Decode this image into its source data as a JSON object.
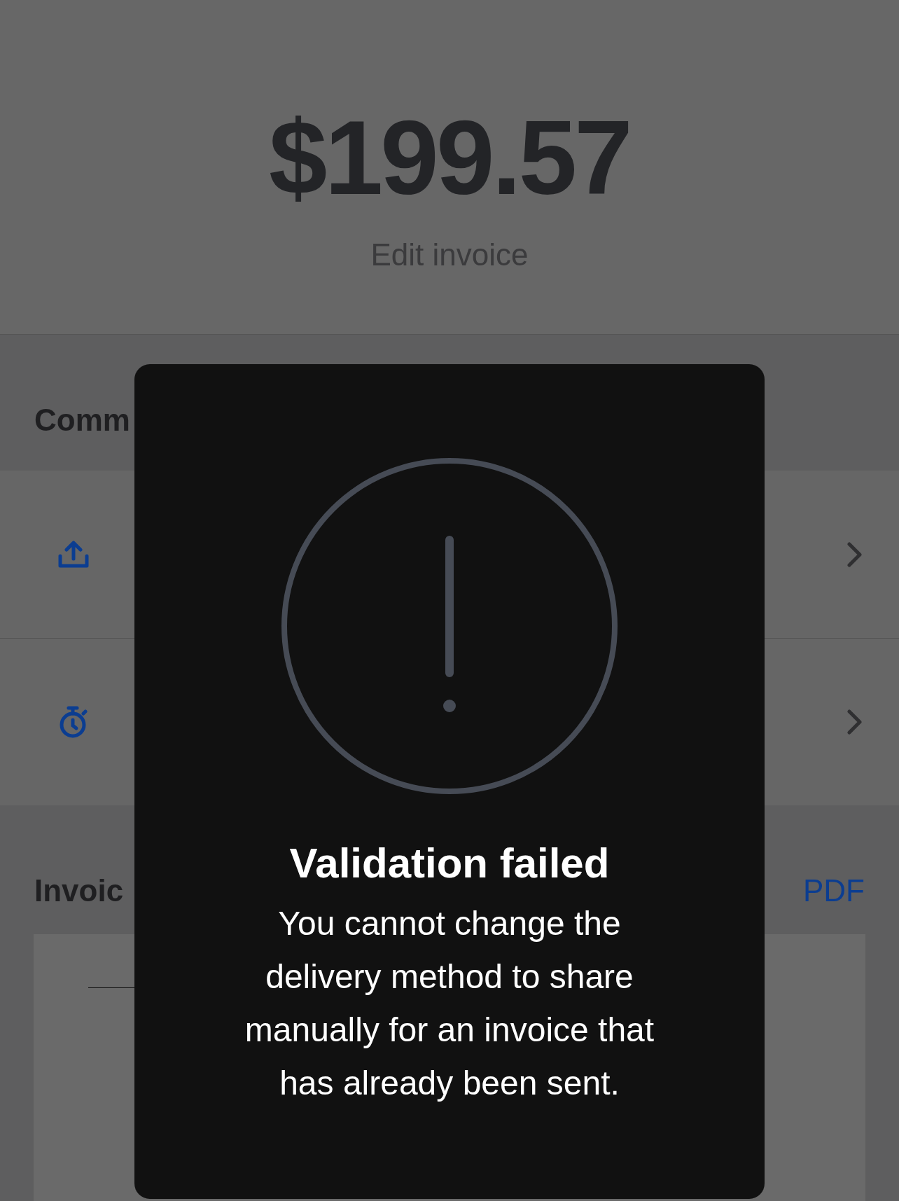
{
  "header": {
    "amount": "$199.57",
    "edit_link": "Edit invoice"
  },
  "communication": {
    "title": "Comm",
    "rows": [
      {
        "kind": "delivery"
      },
      {
        "kind": "reminders"
      }
    ]
  },
  "invoice_preview": {
    "title": "Invoic",
    "action": "PDF"
  },
  "alert": {
    "title": "Validation failed",
    "message": "You cannot change the delivery method to share manually for an invoice that has already been sent."
  }
}
